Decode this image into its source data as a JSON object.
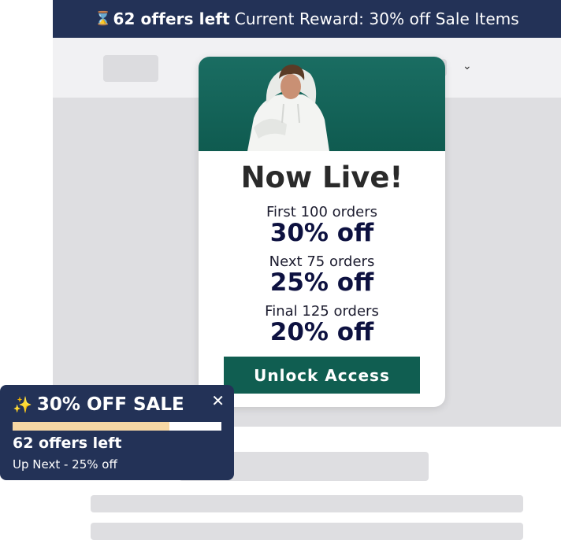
{
  "top_banner": {
    "icon": "hourglass-icon",
    "count_text": "62 offers left",
    "reward_text": "Current Reward: 30% off Sale Items"
  },
  "nav": {
    "chevron_icon": "chevron-down-icon"
  },
  "modal": {
    "image": "man-in-white-hoodie-photo",
    "title": "Now Live!",
    "tiers": [
      {
        "label": "First 100 orders",
        "value": "30% off"
      },
      {
        "label": "Next 75 orders",
        "value": "25% off"
      },
      {
        "label": "Final 125 orders",
        "value": "20% off"
      }
    ],
    "cta_label": "Unlock Access"
  },
  "widget": {
    "icon": "sparkles-icon",
    "title": "30% OFF SALE",
    "close_label": "✕",
    "progress_fraction": 0.75,
    "offers_left": "62 offers left",
    "up_next": "Up Next - 25% off"
  },
  "colors": {
    "navy": "#233257",
    "cta_green": "#105e51",
    "progress_fill": "#f6d7a4",
    "placeholder_gray": "#dedee1"
  }
}
